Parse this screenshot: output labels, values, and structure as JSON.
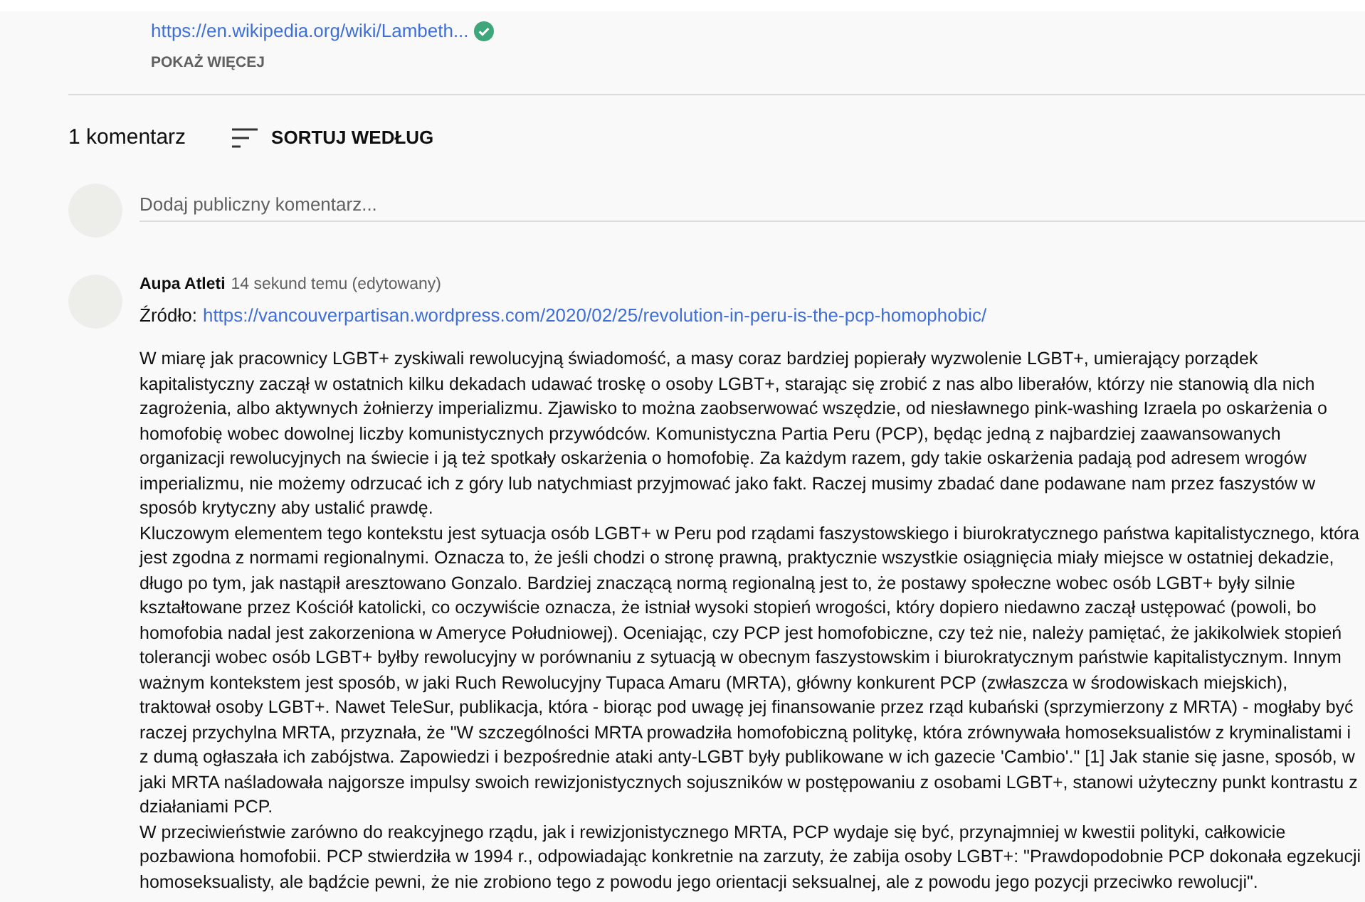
{
  "description": {
    "link": "https://en.wikipedia.org/wiki/Lambeth...",
    "verified": true,
    "show_more": "POKAŻ WIĘCEJ"
  },
  "comments_header": {
    "count": "1 komentarz",
    "sort": "SORTUJ WEDŁUG"
  },
  "add_comment": {
    "placeholder": "Dodaj publiczny komentarz..."
  },
  "comments": [
    {
      "author": "Aupa Atleti",
      "time": "14 sekund temu (edytowany)",
      "source_label": "Źródło:",
      "source_link": "https://vancouverpartisan.wordpress.com/2020/02/25/revolution-in-peru-is-the-pcp-homophobic/",
      "paragraphs": [
        "W miarę jak pracownicy LGBT+ zyskiwali rewolucyjną świadomość, a masy coraz bardziej popierały wyzwolenie LGBT+, umierający porządek kapitalistyczny zaczął w ostatnich kilku dekadach udawać troskę o osoby LGBT+, starając się zrobić z nas albo liberałów, którzy nie stanowią dla nich zagrożenia, albo aktywnych żołnierzy imperializmu. Zjawisko to można zaobserwować wszędzie, od niesławnego pink-washing Izraela po oskarżenia o homofobię wobec dowolnej liczby komunistycznych przywódców. Komunistyczna Partia Peru (PCP), będąc jedną z najbardziej zaawansowanych organizacji rewolucyjnych na świecie i ją też spotkały oskarżenia o homofobię. Za każdym razem, gdy takie oskarżenia padają pod adresem wrogów imperializmu, nie możemy odrzucać ich z góry lub natychmiast przyjmować jako fakt. Raczej musimy zbadać dane podawane nam przez faszystów w sposób krytyczny aby ustalić prawdę.",
        "Kluczowym elementem tego kontekstu jest sytuacja osób LGBT+ w Peru pod rządami faszystowskiego i biurokratycznego państwa kapitalistycznego, która jest zgodna z normami regionalnymi. Oznacza to, że jeśli chodzi o stronę prawną, praktycznie wszystkie osiągnięcia miały miejsce w ostatniej dekadzie, długo po tym, jak nastąpił aresztowano Gonzalo. Bardziej znaczącą normą regionalną jest to, że postawy społeczne wobec osób LGBT+ były silnie kształtowane przez Kościół katolicki, co oczywiście oznacza, że istniał wysoki stopień wrogości, który dopiero niedawno zaczął ustępować (powoli, bo homofobia nadal jest zakorzeniona w Ameryce Południowej). Oceniając, czy PCP jest homofobiczne, czy też nie, należy pamiętać, że jakikolwiek stopień tolerancji wobec osób LGBT+ byłby rewolucyjny w porównaniu z sytuacją w obecnym faszystowskim i biurokratycznym państwie kapitalistycznym. Innym ważnym kontekstem jest sposób, w jaki Ruch Rewolucyjny Tupaca Amaru (MRTA), główny konkurent PCP (zwłaszcza w środowiskach miejskich), traktował osoby LGBT+. Nawet TeleSur, publikacja, która - biorąc pod uwagę jej finansowanie przez rząd kubański (sprzymierzony z MRTA) - mogłaby być raczej przychylna MRTA, przyznała, że \"W szczególności MRTA prowadziła homofobiczną politykę, która zrównywała homoseksualistów z kryminalistami i z dumą ogłaszała ich zabójstwa. Zapowiedzi i bezpośrednie ataki anty-LGBT były publikowane w ich gazecie 'Cambio'.\" [1] Jak stanie się jasne, sposób, w jaki MRTA naśladowała najgorsze impulsy swoich rewizjonistycznych sojuszników w postępowaniu z osobami LGBT+, stanowi użyteczny punkt kontrastu z działaniami PCP.",
        "W przeciwieństwie zarówno do reakcyjnego rządu, jak i rewizjonistycznego MRTA, PCP wydaje się być, przynajmniej w kwestii polityki, całkowicie pozbawiona homofobii. PCP stwierdziła w 1994 r., odpowiadając konkretnie na zarzuty, że zabija osoby LGBT+: \"Prawdopodobnie PCP dokonała egzekucji homoseksualisty, ale bądźcie pewni, że nie zrobiono tego z powodu jego orientacji seksualnej, ale z powodu jego pozycji przeciwko rewolucji\"."
      ]
    }
  ]
}
